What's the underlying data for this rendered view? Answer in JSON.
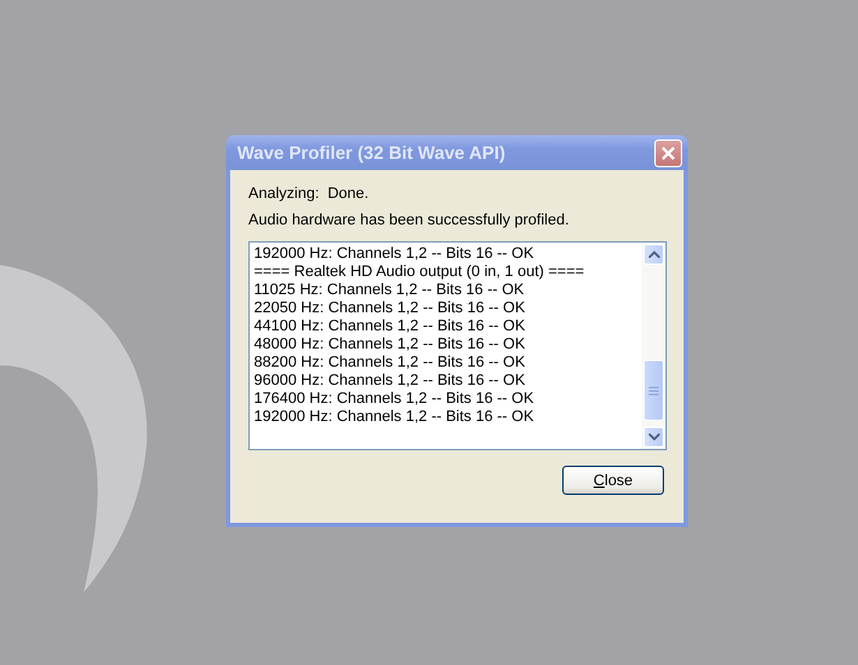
{
  "window": {
    "title": "Wave Profiler (32 Bit Wave API)"
  },
  "status_lines": [
    "Analyzing:  Done.",
    "Audio hardware has been successfully profiled."
  ],
  "log_lines": [
    "192000 Hz: Channels 1,2 -- Bits 16 -- OK",
    "==== Realtek HD Audio output (0 in, 1 out) ====",
    "11025 Hz: Channels 1,2 -- Bits 16 -- OK",
    "22050 Hz: Channels 1,2 -- Bits 16 -- OK",
    "44100 Hz: Channels 1,2 -- Bits 16 -- OK",
    "48000 Hz: Channels 1,2 -- Bits 16 -- OK",
    "88200 Hz: Channels 1,2 -- Bits 16 -- OK",
    "96000 Hz: Channels 1,2 -- Bits 16 -- OK",
    "176400 Hz: Channels 1,2 -- Bits 16 -- OK",
    "192000 Hz: Channels 1,2 -- Bits 16 -- OK"
  ],
  "buttons": [
    "Close"
  ]
}
